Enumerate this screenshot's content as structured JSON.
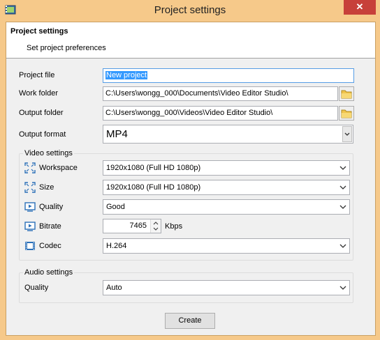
{
  "window": {
    "title": "Project settings",
    "close_glyph": "✕",
    "accent": "#f6c98a",
    "close_color": "#c7403a"
  },
  "header": {
    "title": "Project settings",
    "subtitle": "Set project preferences"
  },
  "project_file": {
    "label": "Project file",
    "value": "New project"
  },
  "work_folder": {
    "label": "Work folder",
    "value": "C:\\Users\\wongg_000\\Documents\\Video Editor Studio\\"
  },
  "output_folder": {
    "label": "Output folder",
    "value": "C:\\Users\\wongg_000\\Videos\\Video Editor Studio\\"
  },
  "output_format": {
    "label": "Output format",
    "value": "MP4"
  },
  "video_settings": {
    "title": "Video settings",
    "workspace": {
      "label": "Workspace",
      "value": "1920x1080 (Full HD 1080p)",
      "icon": "expand-icon"
    },
    "size": {
      "label": "Size",
      "value": "1920x1080 (Full HD 1080p)",
      "icon": "expand-icon"
    },
    "quality": {
      "label": "Quality",
      "value": "Good",
      "icon": "screen-play-icon"
    },
    "bitrate": {
      "label": "Bitrate",
      "value": "7465",
      "unit": "Kbps",
      "icon": "screen-play-icon"
    },
    "codec": {
      "label": "Codec",
      "value": "H.264",
      "icon": "film-icon"
    }
  },
  "audio_settings": {
    "title": "Audio settings",
    "quality": {
      "label": "Quality",
      "value": "Auto"
    }
  },
  "actions": {
    "create_label": "Create"
  }
}
